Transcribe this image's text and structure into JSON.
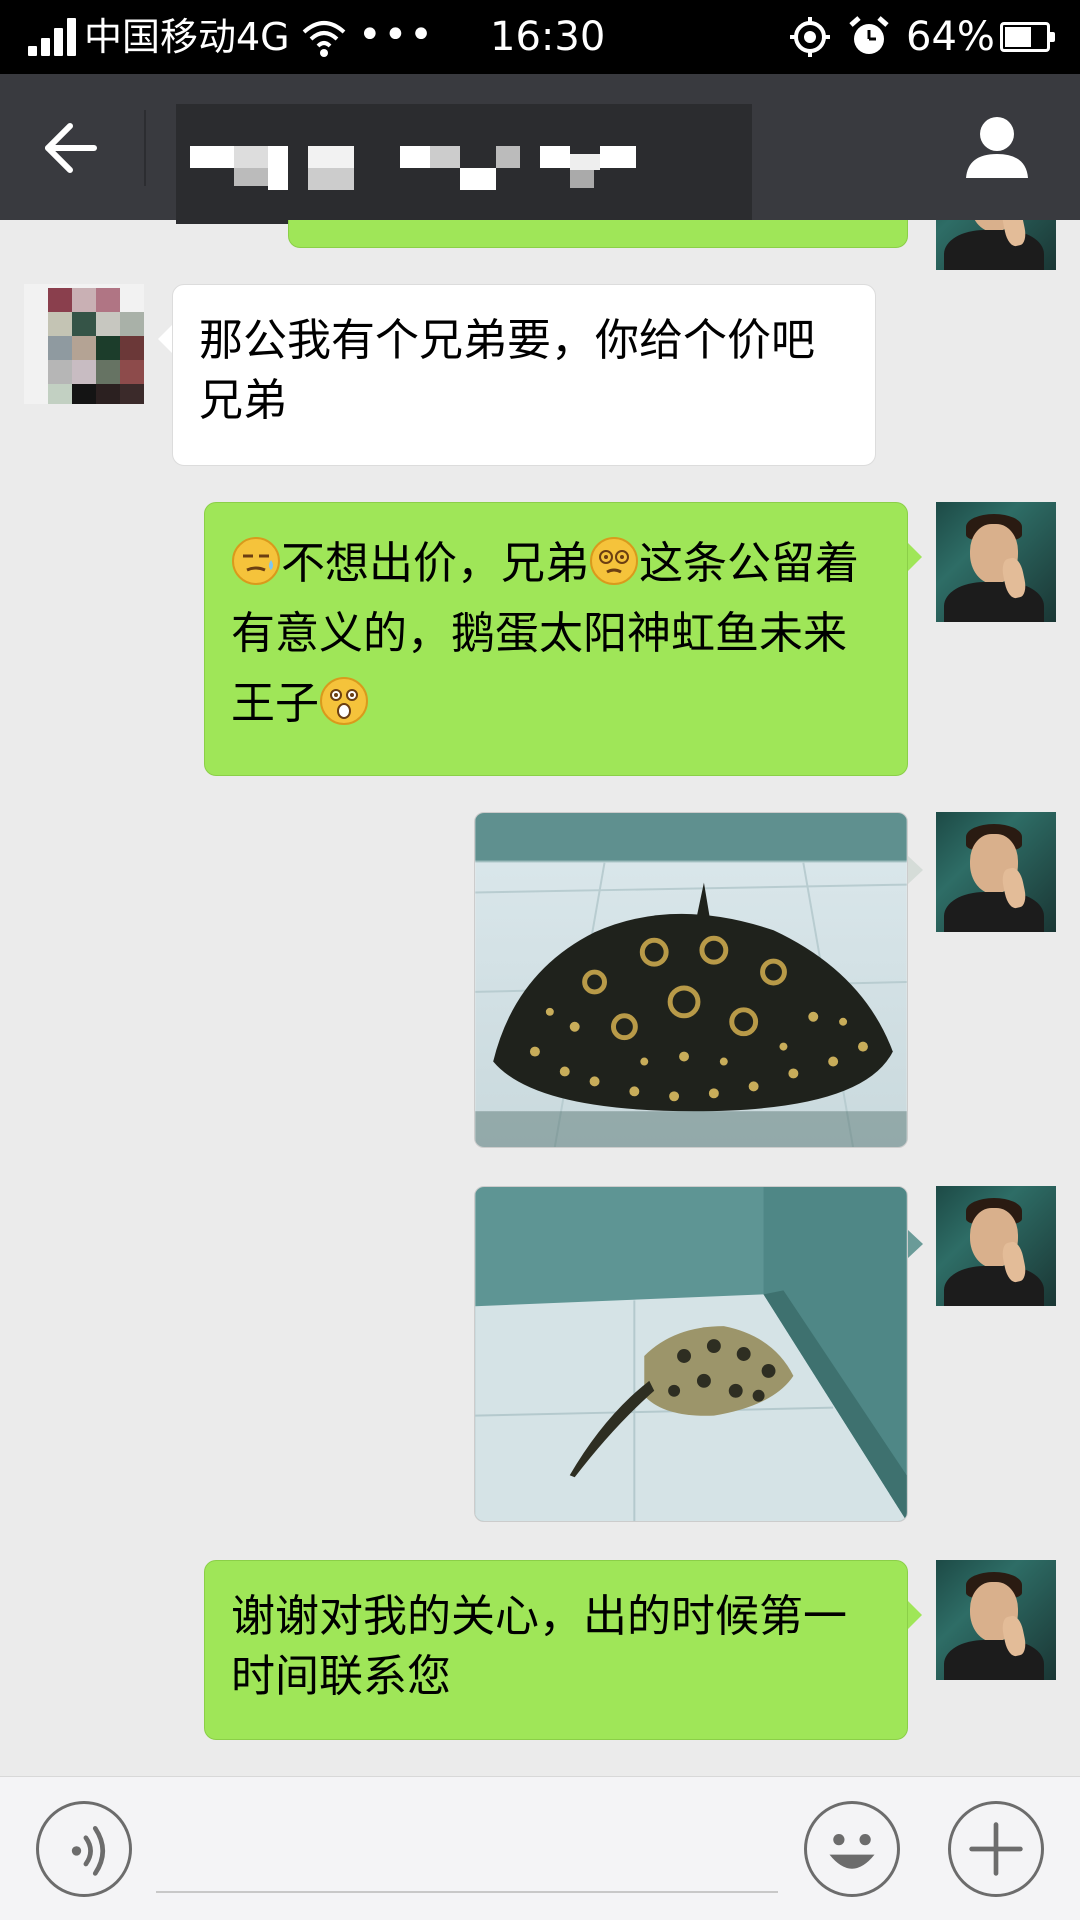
{
  "status_bar": {
    "carrier": "中国移动4G",
    "dots": "•••",
    "time": "16:30",
    "battery_percent": "64%",
    "battery_level": 0.64
  },
  "nav": {
    "title": "",
    "back_icon": "arrow-left-icon",
    "profile_icon": "person-icon"
  },
  "messages": [
    {
      "from": "other",
      "type": "text",
      "text": "那公我有个兄弟要，你给个价吧兄弟"
    },
    {
      "from": "me",
      "type": "text",
      "parts": [
        "不想出价，兄弟",
        "这条公留着有意义的，鹅蛋太阳神虹鱼未来王子"
      ],
      "emojis": [
        "smirk-sweat-emoji",
        "dizzy-face-emoji",
        "surprised-face-emoji"
      ]
    },
    {
      "from": "me",
      "type": "image",
      "icon": "stingray-photo"
    },
    {
      "from": "me",
      "type": "image",
      "icon": "stingray-photo"
    },
    {
      "from": "me",
      "type": "text",
      "text": "谢谢对我的关心，出的时候第一时间联系您"
    }
  ],
  "input_bar": {
    "placeholder": "",
    "voice_icon": "voice-icon",
    "emoji_icon": "smiley-icon",
    "plus_icon": "plus-icon"
  },
  "colors": {
    "nav_bg": "#393a3f",
    "chat_bg": "#ebebeb",
    "my_bubble": "#9fe658",
    "their_bubble": "#ffffff"
  }
}
